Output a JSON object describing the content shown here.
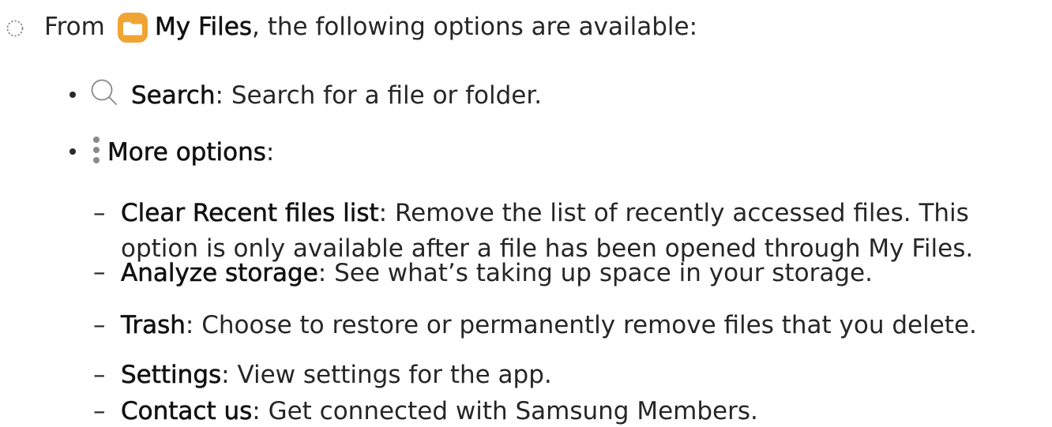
{
  "intro": {
    "prefix": "From",
    "app_name": "My Files",
    "suffix": ", the following options are available:",
    "step_icon": "dotted-circle-icon",
    "app_icon": "folder-app-icon",
    "app_icon_color": "#F0A433"
  },
  "options": [
    {
      "icon": "search-icon",
      "title": "Search",
      "description": ": Search for a file or folder."
    },
    {
      "icon": "more-options-icon",
      "title": "More options",
      "description": ":"
    }
  ],
  "more_options_items": [
    {
      "title": "Clear Recent files list",
      "description": ": Remove the list of recently accessed files. This",
      "continuation": "option is only available after a file has been opened through My Files."
    },
    {
      "title": "Analyze storage",
      "description": ": See what’s taking up space in your storage."
    },
    {
      "title": "Trash",
      "description": ": Choose to restore or permanently remove files that you delete."
    },
    {
      "title": "Settings",
      "description": ": View settings for the app."
    },
    {
      "title": "Contact us",
      "description": ": Get connected with Samsung Members."
    }
  ],
  "dash_glyph": "–"
}
